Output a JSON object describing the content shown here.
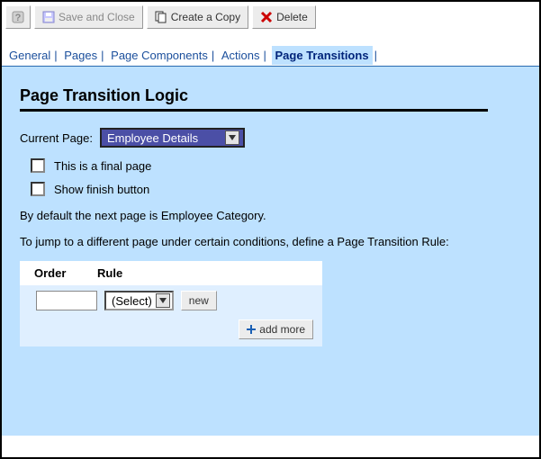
{
  "toolbar": {
    "save_label": "Save and Close",
    "copy_label": "Create a Copy",
    "delete_label": "Delete"
  },
  "tabs": {
    "items": [
      "General",
      "Pages",
      "Page Components",
      "Actions",
      "Page Transitions"
    ],
    "active_index": 4
  },
  "panel": {
    "title": "Page Transition Logic",
    "current_page_label": "Current Page:",
    "current_page_value": "Employee Details",
    "chk_final_label": "This is a final page",
    "chk_finish_label": "Show finish button",
    "default_text": "By default the next page is Employee Category.",
    "jump_text": "To jump to a different page under certain conditions, define a Page Transition Rule:"
  },
  "rules": {
    "col_order": "Order",
    "col_rule": "Rule",
    "order_value": "",
    "rule_select_value": "(Select)",
    "new_label": "new",
    "addmore_label": "add more"
  }
}
